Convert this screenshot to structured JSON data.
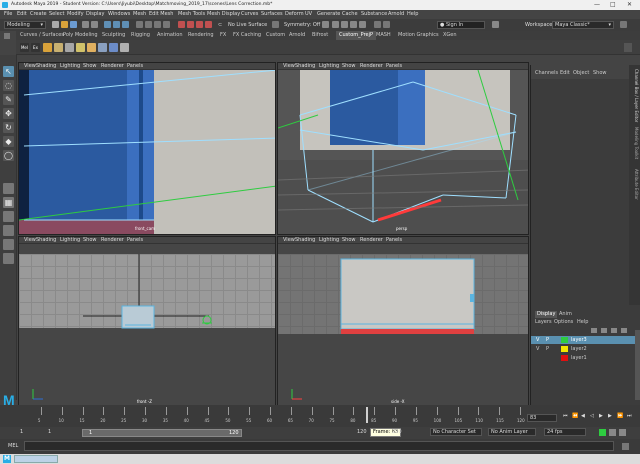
{
  "title_bar": {
    "text": "Autodesk Maya 2019 - Student Version: C:\\Users\\Jiyubi\\Desktop\\Matchmoving_2019_17\\scenes\\Lens Correction.mb*",
    "minimize": "—",
    "maximize": "□",
    "close": "✕"
  },
  "menu": [
    "File",
    "Edit",
    "Create",
    "Select",
    "Modify",
    "Display",
    "Windows",
    "Mesh",
    "Edit Mesh",
    "Mesh Tools",
    "Mesh Display",
    "Curves",
    "Surfaces",
    "Deform",
    "UV",
    "Generate",
    "Cache",
    "Substance",
    "Arnold",
    "Help"
  ],
  "status_line": {
    "mode": "Modeling",
    "live_surface": "No Live Surface",
    "symmetry": "Symmetry: Off",
    "sign_in": "Sign In",
    "workspace_label": "Workspace:",
    "workspace": "Maya Classic*"
  },
  "shelf_tabs": [
    "Curves / Surfaces",
    "Poly Modeling",
    "Sculpting",
    "Rigging",
    "Animation",
    "Rendering",
    "FX",
    "FX Caching",
    "Custom",
    "Arnold",
    "Bifrost",
    "Custom_PrejP",
    "MASH",
    "Motion Graphics",
    "XGen"
  ],
  "shelf_icon_labels": [
    "Mel",
    "Ex"
  ],
  "panel_menu": [
    "View",
    "Shading",
    "Lighting",
    "Show",
    "Renderer",
    "Panels"
  ],
  "viewports": {
    "top_left_label": "front_cam",
    "top_right_label": "persp",
    "bottom_left_label": "front -Z",
    "bottom_right_label": "side -X"
  },
  "channel_box": {
    "tabs": [
      "Channels",
      "Edit",
      "Object",
      "Show"
    ]
  },
  "side_tabs": [
    "Channel Box / Layer Editor",
    "Modeling Toolkit",
    "Attribute Editor"
  ],
  "layer_editor": {
    "tabs": [
      "Display",
      "Anim"
    ],
    "menu": [
      "Layers",
      "Options",
      "Help"
    ],
    "layers": [
      {
        "vis": "V",
        "play": "P",
        "name": "layer3",
        "color": "#2ecc40",
        "selected": true
      },
      {
        "vis": "V",
        "play": "P",
        "name": "layer2",
        "color": "#f2e600",
        "selected": false
      },
      {
        "vis": "",
        "play": "",
        "name": "layer1",
        "color": "#e01010",
        "selected": false
      }
    ]
  },
  "timeline": {
    "ticks": [
      "5",
      "10",
      "15",
      "20",
      "25",
      "30",
      "35",
      "40",
      "45",
      "50",
      "55",
      "60",
      "65",
      "70",
      "75",
      "80",
      "85",
      "90",
      "95",
      "100",
      "105",
      "110",
      "115",
      "120"
    ],
    "current_frame": "83",
    "playhead_frame": 83
  },
  "range": {
    "start": "1",
    "anim_start": "1",
    "slider_start": "1",
    "slider_end": "120",
    "end": "120",
    "anim_end": "200",
    "tooltip": "Frame: 83",
    "character_set": "No Character Set",
    "anim_layer": "No Anim Layer",
    "fps": "24 fps"
  },
  "command_line": {
    "lang": "MEL"
  },
  "taskbar": {
    "app": "M"
  },
  "colors": {
    "accent": "#5ab4e0",
    "selection": "#5a90b0",
    "maya_logo": "#29aee6"
  }
}
